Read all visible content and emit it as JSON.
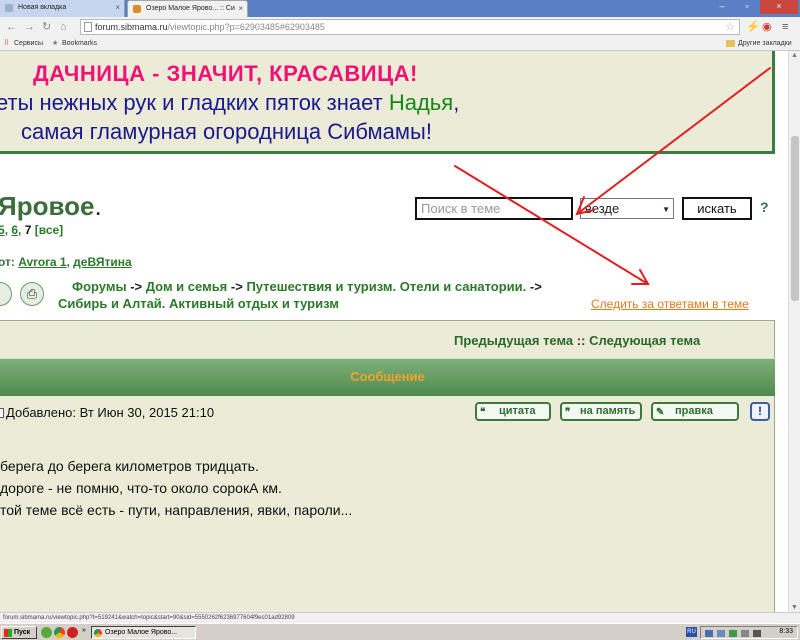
{
  "browser": {
    "tabs": [
      {
        "title": "Новая вкладка",
        "favicon_color": "#9bb0d6"
      },
      {
        "title": "Озеро Малое Ярово... :: Си",
        "favicon_color": "#e08b2b"
      }
    ],
    "url": {
      "host": "forum.sibmama.ru",
      "path": "/viewtopic.php?p=62903485#62903485"
    },
    "bookmarks": {
      "apps": "Сервисы",
      "bookmarks": "Bookmarks",
      "other": "Другие закладки"
    }
  },
  "banner": {
    "line1": "ДАЧНИЦА - ЗНАЧИТ, КРАСАВИЦА!",
    "line2_prefix": "еты нежных рук и гладких пяток знает ",
    "line2_name": "Надья",
    "line2_suffix": ",",
    "line3": "самая гламурная огородница Сибмамы!"
  },
  "topic": {
    "title": "Яровое",
    "title_dot": ".",
    "pages": {
      "p5": "5",
      "p6": "6",
      "current": "7",
      "all": "[все]"
    }
  },
  "search": {
    "placeholder": "Поиск в теме",
    "scope": "везде",
    "button": "искать",
    "help": "?"
  },
  "moderators": {
    "label": "от:",
    "user1": "Avrora 1",
    "user2": "деВЯтина"
  },
  "breadcrumb": {
    "forums": "Форумы",
    "home_family": "Дом и семья",
    "travel": "Путешествия и туризм. Отели и санатории.",
    "siberia": "Сибирь и Алтай. Активный отдых и туризм",
    "sep": "->"
  },
  "follow_link": "Следить за ответами в теме",
  "topic_nav": {
    "prev": "Предыдущая тема",
    "sep": "::",
    "next": "Следующая тема"
  },
  "message_header": "Сообщение",
  "post": {
    "posted": "Добавлено: Вт Июн 30, 2015 21:10",
    "buttons": {
      "quote": "цитата",
      "memo": "на память",
      "edit": "правка",
      "report": "!"
    },
    "body": [
      "берега до берега километров тридцать.",
      "дороге - не помню, что-то около сорокА км.",
      "той теме всё есть - пути, направления, явки, пароли..."
    ]
  },
  "status_url": "forum.sibmama.ru/viewtopic.php?t=519241&watch=topic&start=90&sid=5550262f6236977604f9ec01ad92809",
  "taskbar": {
    "start": "Пуск",
    "task": "Озеро Малое Ярово...",
    "lang": "RU",
    "time": "8:33"
  },
  "colors": {
    "annotation_arrow": "#e02020",
    "banner_bg": "#ecebd8",
    "forum_green": "#3c6e3c",
    "link_orange": "#e07a1a"
  }
}
